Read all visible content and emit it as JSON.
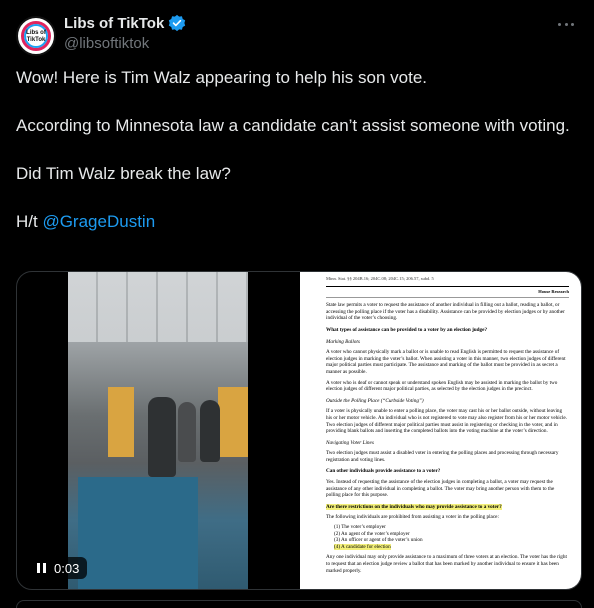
{
  "author": {
    "name": "Libs of TikTok",
    "handle": "@libsoftiktok",
    "avatar_text": "Libs of TikTok",
    "verified_color": "#1d9bf0"
  },
  "tweet": {
    "line1": "Wow! Here is Tim Walz appearing to help his son vote.",
    "line2": "According to Minnesota law a candidate can’t assist someone with voting.",
    "line3": "Did Tim Walz break the law?",
    "line4_prefix": "H/t ",
    "line4_mention": "@GrageDustin"
  },
  "video": {
    "time": "0:03"
  },
  "document": {
    "citation": "Minn. Stat. §§ 204B.16; 204C.08; 204C.15; 206.57, subd. 5",
    "section_label": "House Research",
    "intro": "State law permits a voter to request the assistance of another individual in filling out a ballot, reading a ballot, or accessing the polling place if the voter has a disability. Assistance can be provided by election judges or by another individual of the voter’s choosing.",
    "q1": "What types of assistance can be provided to a voter by an election judge?",
    "h1": "Marking Ballots",
    "p1": "A voter who cannot physically mark a ballot or is unable to read English is permitted to request the assistance of election judges in marking the voter’s ballot. When assisting a voter in this manner, two election judges of different major political parties must participate. The assistance and marking of the ballot must be provided in as secret a manner as possible.",
    "p2": "A voter who is deaf or cannot speak or understand spoken English may be assisted in marking the ballot by two election judges of different major political parties, as selected by the election judges in the precinct.",
    "h2": "Outside the Polling Place (“Curbside Voting”)",
    "p3": "If a voter is physically unable to enter a polling place, the voter may cast his or her ballot outside, without leaving his or her motor vehicle. An individual who is not registered to vote may also register from his or her motor vehicle. Two election judges of different major political parties must assist in registering or checking in the voter, and in providing blank ballots and inserting the completed ballots into the voting machine at the voter’s direction.",
    "h3": "Navigating Voter Lines",
    "p4": "Two election judges must assist a disabled voter in entering the polling places and processing through necessary registration and voting lines.",
    "q2": "Can other individuals provide assistance to a voter?",
    "p5": "Yes. Instead of requesting the assistance of the election judges in completing a ballot, a voter may request the assistance of any other individual in completing a ballot. The voter may bring another person with them to the polling place for this purpose.",
    "q3": "Are there restrictions on the individuals who may provide assistance to a voter?",
    "p6": "The following individuals are prohibited from assisting a voter in the polling place:",
    "list": [
      "(1) The voter’s employer",
      "(2) An agent of the voter’s employer",
      "(3) An officer or agent of the voter’s union",
      "(4) A candidate for election"
    ],
    "p7": "Any one individual may only provide assistance to a maximum of three voters at an election. The voter has the right to request that an election judge review a ballot that has been marked by another individual to ensure it has been marked properly."
  }
}
